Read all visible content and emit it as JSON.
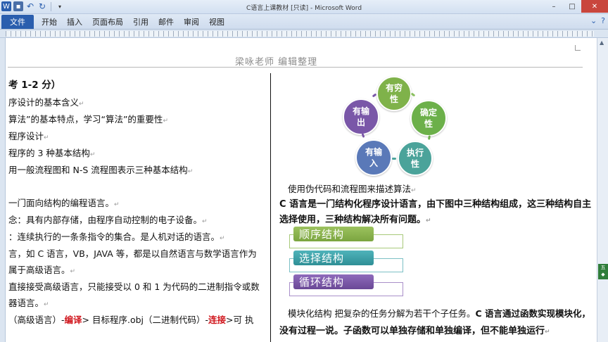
{
  "window": {
    "title": "C语言上课教材 [只读] - Microsoft Word",
    "file_tab": "文件",
    "tabs": [
      "开始",
      "插入",
      "页面布局",
      "引用",
      "邮件",
      "审阅",
      "视图"
    ]
  },
  "header": {
    "text": "梁咏老师 编辑整理"
  },
  "left_column": {
    "line1": "考 1-2 分）",
    "line2": "序设计的基本含义",
    "line3": "算法”的基本特点，学习“算法”的重要性",
    "line4": "程序设计",
    "line5": "程序的 3 种基本结构",
    "line6": "用一般流程图和 N-S 流程图表示三种基本结构",
    "line7": "一门面向结构的编程语言。",
    "line8": "念：具有内部存储，由程序自动控制的电子设备。",
    "line9": "：连续执行的一条条指令的集合。是人机对话的语言。",
    "line10": "言，如 C 语言，VB，JAVA 等，都是以自然语言与数学语言作为",
    "line11": "属于高级语言。",
    "line12": "直接接受高级语言，只能接受以 0 和 1 为代码的二进制指令或数",
    "line13": "器语言。",
    "line14_a": "（高级语言）-",
    "line14_b": "编译",
    "line14_c": "> 目标程序.obj（二进制代码）-",
    "line14_d": "连接",
    "line14_e": ">可 执"
  },
  "diagram": {
    "circles": [
      {
        "label": "有穷\n性",
        "color": "#7fb24a"
      },
      {
        "label": "确定\n性",
        "color": "#6cb04a"
      },
      {
        "label": "执行\n性",
        "color": "#4ba39a"
      },
      {
        "label": "有输\n入",
        "color": "#5a79b8"
      },
      {
        "label": "有输\n出",
        "color": "#7a57a8"
      }
    ]
  },
  "right_column": {
    "text1": "使用伪代码和流程图来描述算法",
    "text2": "C 语言是一门结构化程序设计语言，由下图中三种结构组成，这三种结构自主",
    "text3": "选择使用，三种结构解决所有问题。",
    "structures": [
      {
        "label": "顺序结构",
        "color": "#8bb54a",
        "border": "#a8c97a"
      },
      {
        "label": "选择结构",
        "color": "#3d9fa6",
        "border": "#7cc0c5"
      },
      {
        "label": "循环结构",
        "color": "#7a57a8",
        "border": "#a98fc9"
      }
    ],
    "text4_a": "模块化结构  把复杂的任务分解为若干个子任务。",
    "text4_b": "C 语言通过函数实现模块化，",
    "text5": "没有过程一说。子函数可以单独存储和单独编译，但不能单独运行"
  },
  "side_widget": {
    "text": "五"
  }
}
